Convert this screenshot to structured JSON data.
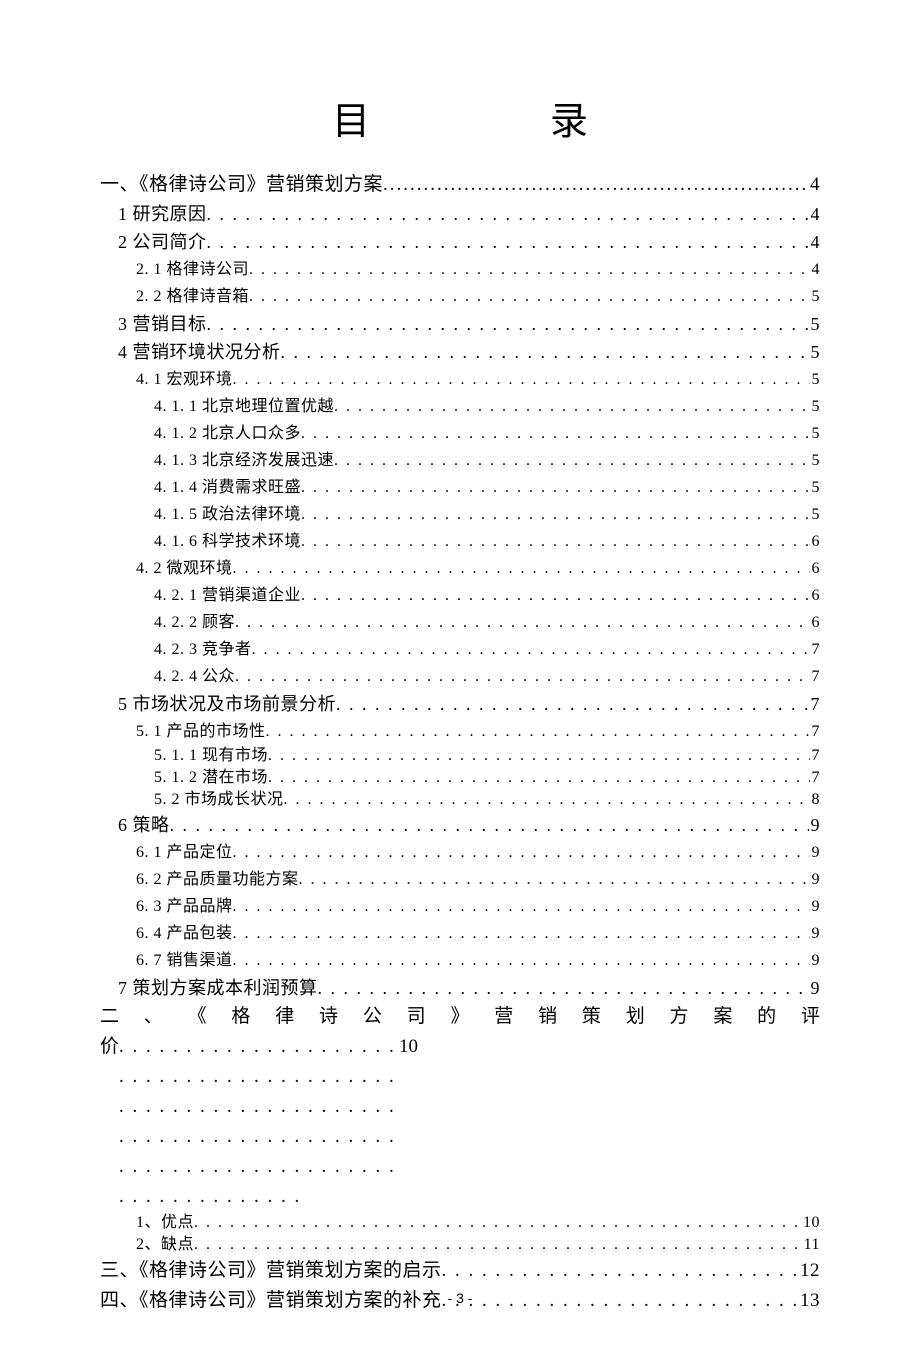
{
  "title": "目录",
  "leader": ". . . . . . . . . . . . . . . . . . . . . . . . . . . . . . . . . . . . . . . . . . . . . . . . . . . . . . . . . . . . . . . . . . . . . . . . . . . . . . . . . . . . . . . . . . . . . . . . . . . . . . . . . . . . . . . . . . . . . . .",
  "leader_solid": ".......................................................................................................................................................................................",
  "page_number": "- 3 -",
  "entries": [
    {
      "level": 1,
      "label": "一、《格律诗公司》营销策划方案",
      "page": "4",
      "leader_style": "solid"
    },
    {
      "level": 2,
      "label": "1 研究原因",
      "page": "4"
    },
    {
      "level": 2,
      "label": "2 公司简介",
      "page": "4"
    },
    {
      "level": 3,
      "label": "2. 1 格律诗公司",
      "page": "4"
    },
    {
      "level": 3,
      "label": "2. 2 格律诗音箱",
      "page": "5"
    },
    {
      "level": 2,
      "label": "3 营销目标",
      "page": "5"
    },
    {
      "level": 2,
      "label": "4 营销环境状况分析",
      "page": "5"
    },
    {
      "level": 3,
      "label": "4. 1 宏观环境",
      "page": "5"
    },
    {
      "level": 4,
      "label": "4. 1. 1 北京地理位置优越",
      "page": "5"
    },
    {
      "level": 4,
      "label": "4. 1. 2 北京人口众多",
      "page": "5"
    },
    {
      "level": 4,
      "label": "4. 1. 3 北京经济发展迅速",
      "page": "5"
    },
    {
      "level": 4,
      "label": "4. 1. 4 消费需求旺盛",
      "page": "5"
    },
    {
      "level": 4,
      "label": "4. 1. 5 政治法律环境",
      "page": "5"
    },
    {
      "level": 4,
      "label": "4. 1. 6 科学技术环境",
      "page": "6"
    },
    {
      "level": 3,
      "label": "4. 2 微观环境",
      "page": "6"
    },
    {
      "level": 4,
      "label": "4. 2. 1 营销渠道企业",
      "page": "6"
    },
    {
      "level": 4,
      "label": "4. 2. 2 顾客",
      "page": "6"
    },
    {
      "level": 4,
      "label": "4. 2. 3 竞争者",
      "page": "7"
    },
    {
      "level": 4,
      "label": "4. 2. 4 公众",
      "page": "7"
    },
    {
      "level": 2,
      "label": "5 市场状况及市场前景分析",
      "page": "7"
    },
    {
      "level": 3,
      "label": "5. 1 产品的市场性",
      "page": "7"
    },
    {
      "level": 4,
      "label": "5. 1. 1 现有市场",
      "page": "7",
      "tight": true
    },
    {
      "level": 4,
      "label": "5. 1. 2 潜在市场",
      "page": "7",
      "tight": true
    },
    {
      "level": 4,
      "label": "5. 2 市场成长状况",
      "page": "8",
      "tight": true
    },
    {
      "level": 2,
      "label": "6 策略",
      "page": "9"
    },
    {
      "level": 3,
      "label": "6. 1 产品定位",
      "page": "9"
    },
    {
      "level": 3,
      "label": "6. 2 产品质量功能方案",
      "page": "9"
    },
    {
      "level": 3,
      "label": "6. 3 产品品牌",
      "page": "9"
    },
    {
      "level": 3,
      "label": "6. 4 产品包装",
      "page": "9"
    },
    {
      "level": 3,
      "label": "6. 7 销售渠道",
      "page": "9"
    },
    {
      "level": 2,
      "label": "7 策划方案成本利润预算",
      "page": "9"
    }
  ],
  "justified_entry": {
    "line1": "二 、 《 格 律 诗 公 司 》 营 销 策 划 方 案 的 评",
    "line2_label": "价",
    "page": "10"
  },
  "tail_entries": [
    {
      "level": 3,
      "label": "1、优点",
      "page": "10",
      "tight": true
    },
    {
      "level": 3,
      "label": "2、缺点",
      "page": "11",
      "tight": true
    },
    {
      "level": 1,
      "label": "三、《格律诗公司》营销策划方案的启示",
      "page": "12"
    },
    {
      "level": 1,
      "label": "四、《格律诗公司》营销策划方案的补充",
      "page": "13"
    }
  ]
}
